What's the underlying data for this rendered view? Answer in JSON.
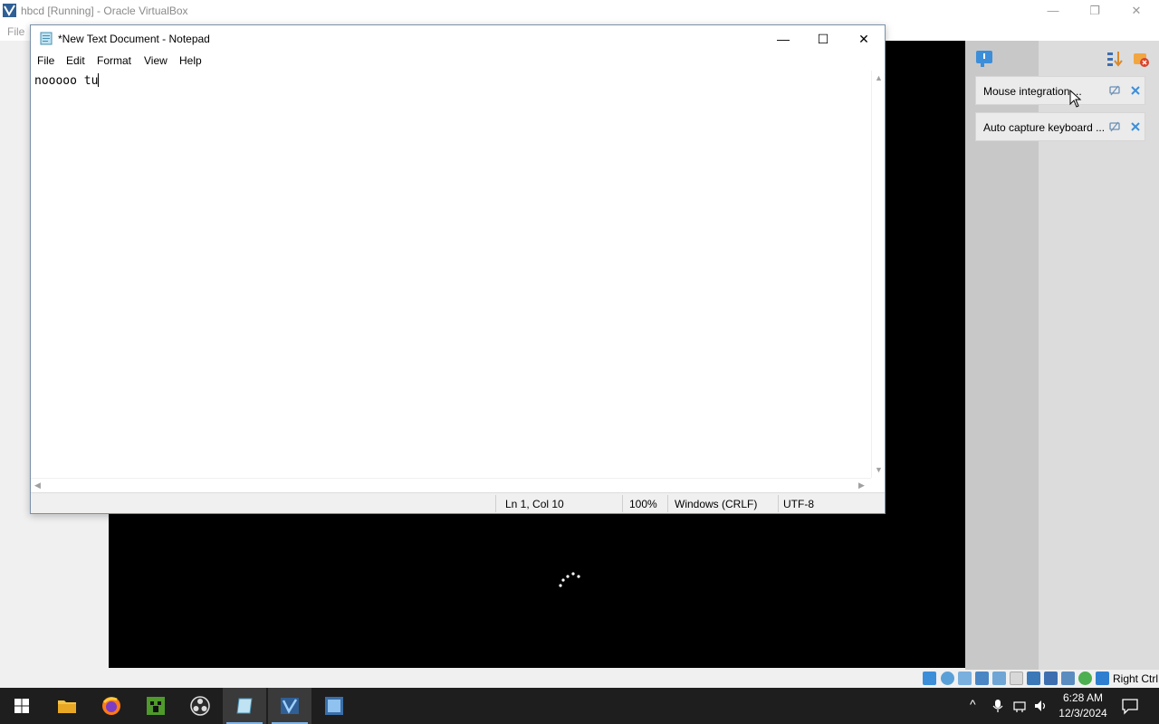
{
  "host_window": {
    "title": "hbcd [Running] - Oracle VirtualBox",
    "menu_file": "File",
    "minimize": "—",
    "restore": "❐",
    "close": "✕"
  },
  "notepad": {
    "title": "*New Text Document - Notepad",
    "menu": [
      "File",
      "Edit",
      "Format",
      "View",
      "Help"
    ],
    "content": "nooooo tu",
    "status": {
      "position": "Ln 1, Col 10",
      "zoom": "100%",
      "line_endings": "Windows (CRLF)",
      "encoding": "UTF-8"
    }
  },
  "notifications": {
    "items": [
      {
        "label": "Mouse integration ..."
      },
      {
        "label": "Auto capture keyboard ..."
      }
    ]
  },
  "vbox_status": {
    "host_key": "Right Ctrl"
  },
  "taskbar": {
    "apps": [
      "start",
      "file-explorer",
      "firefox",
      "minecraft",
      "obs-studio",
      "notepad",
      "virtualbox",
      "hbcd"
    ],
    "time": "6:28 AM",
    "date": "12/3/2024"
  }
}
